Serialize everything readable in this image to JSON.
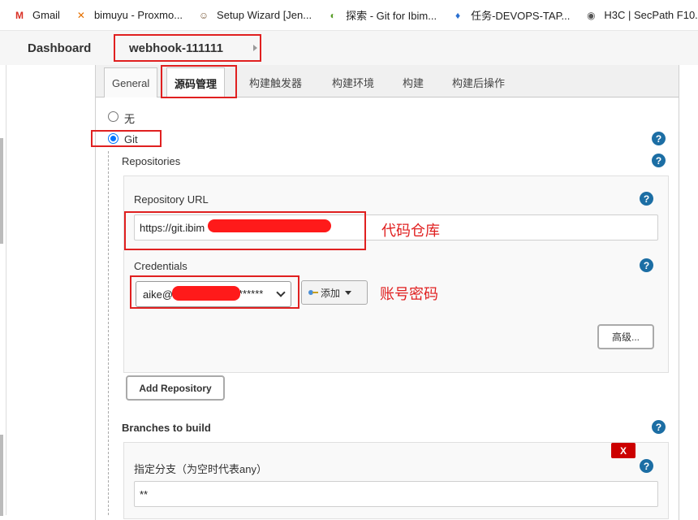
{
  "bookmarks": [
    {
      "icon": "gmail-icon",
      "label": "Gmail",
      "color": "#d93025",
      "glyph": "M"
    },
    {
      "icon": "proxmox-icon",
      "label": "bimuyu - Proxmo...",
      "color": "#e57000",
      "glyph": "✕"
    },
    {
      "icon": "jenkins-icon",
      "label": "Setup Wizard [Jen...",
      "color": "#7a5a3a",
      "glyph": "☺"
    },
    {
      "icon": "gitee-icon",
      "label": "探索 - Git for Ibim...",
      "color": "#5a9e2a",
      "glyph": "◐"
    },
    {
      "icon": "tapd-icon",
      "label": "任务-DEVOPS-TAP...",
      "color": "#2a6fd0",
      "glyph": "♦"
    },
    {
      "icon": "globe-icon",
      "label": "H3C | SecPath F10...",
      "color": "#555555",
      "glyph": "◉"
    }
  ],
  "breadcrumb": {
    "dashboard": "Dashboard",
    "job": "webhook-111111"
  },
  "tabs": [
    {
      "label": "General"
    },
    {
      "label": "源码管理"
    },
    {
      "label": "构建触发器"
    },
    {
      "label": "构建环境"
    },
    {
      "label": "构建"
    },
    {
      "label": "构建后操作"
    }
  ],
  "scm": {
    "none_label": "无",
    "git_label": "Git",
    "repositories_title": "Repositories",
    "repo_url_label": "Repository URL",
    "repo_url_value": "https://git.ibim",
    "credentials_label": "Credentials",
    "credentials_value": "aike@",
    "credentials_suffix": "******",
    "add_label": "添加",
    "advanced_label": "高级...",
    "add_repository_label": "Add Repository",
    "branches_title": "Branches to build",
    "branch_label": "指定分支（为空时代表any）",
    "branch_value": "**",
    "delete_label": "X",
    "help_glyph": "?"
  },
  "annotations": {
    "repo": "代码仓库",
    "account": "账号密码"
  },
  "colors": {
    "annotation_red": "#e02020",
    "help_blue": "#1c6ea4",
    "radio_blue": "#0075ff"
  }
}
